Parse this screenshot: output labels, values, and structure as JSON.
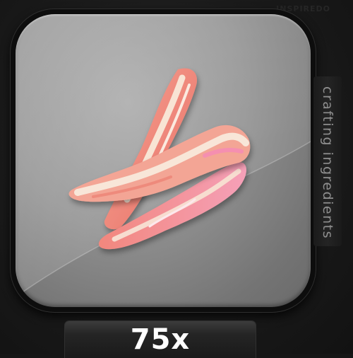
{
  "watermark": "INSPIREDO",
  "item": {
    "category": "crafting ingredients",
    "quantity": "75x",
    "icon": "bacon-strips-icon"
  },
  "colors": {
    "tile": "#8f8f8f",
    "meat": "#f08a7e",
    "fat": "#f6e2d2",
    "background": "#161616"
  }
}
